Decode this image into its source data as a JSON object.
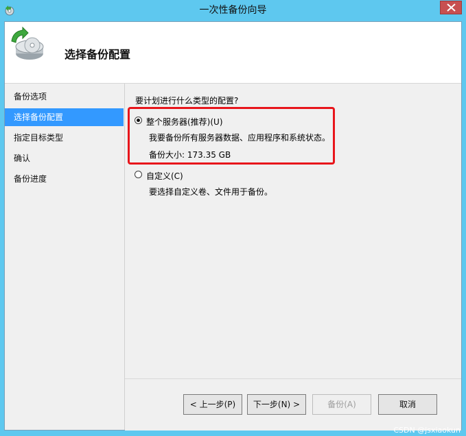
{
  "window": {
    "title": "一次性备份向导",
    "close_label": "✕"
  },
  "header": {
    "title": "选择备份配置"
  },
  "nav": {
    "items": [
      {
        "label": "备份选项",
        "active": false
      },
      {
        "label": "选择备份配置",
        "active": true
      },
      {
        "label": "指定目标类型",
        "active": false
      },
      {
        "label": "确认",
        "active": false
      },
      {
        "label": "备份进度",
        "active": false
      }
    ]
  },
  "main": {
    "question": "要计划进行什么类型的配置?",
    "option_full": {
      "label": "整个服务器(推荐)(U)",
      "description": "我要备份所有服务器数据、应用程序和系统状态。",
      "size": "备份大小: 173.35 GB",
      "selected": true
    },
    "option_custom": {
      "label": "自定义(C)",
      "description": "要选择自定义卷、文件用于备份。",
      "selected": false
    }
  },
  "buttons": {
    "prev": "< 上一步(P)",
    "next": "下一步(N) >",
    "backup": "备份(A)",
    "cancel": "取消"
  },
  "watermark": "CSDN @jsxiaokun",
  "colors": {
    "titlebar": "#5ec8ef",
    "nav_active": "#3399ff",
    "highlight": "#e8151b",
    "close": "#c75050"
  }
}
